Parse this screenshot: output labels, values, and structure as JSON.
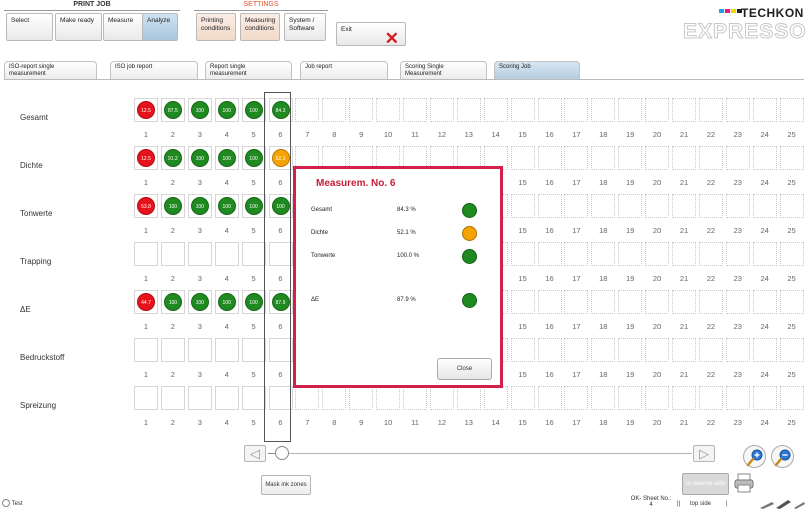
{
  "header": {
    "group_print_job": "PRINT JOB",
    "group_settings": "SETTINGS",
    "buttons": {
      "select": "Select",
      "make_ready": "Make ready",
      "measure": "Measure",
      "analyze": "Analyze",
      "printing_conditions_1": "Printing",
      "printing_conditions_2": "conditions",
      "measuring_conditions_1": "Measuring",
      "measuring_conditions_2": "conditions",
      "system_1": "System /",
      "system_2": "Software",
      "exit": "Exit"
    },
    "logo_brand": "TECHKON",
    "logo_main": "EXPRESSO"
  },
  "report_tabs": [
    {
      "line1": "ISO-report single",
      "line2": "measurement"
    },
    {
      "line1": "ISO job report",
      "line2": ""
    },
    {
      "line1": "Report single",
      "line2": "measurement"
    },
    {
      "line1": "Job report",
      "line2": ""
    },
    {
      "line1": "Scoring Single",
      "line2": "Measurement"
    },
    {
      "line1": "Scoring Job",
      "line2": ""
    }
  ],
  "column_numbers": [
    "1",
    "2",
    "3",
    "4",
    "5",
    "6",
    "7",
    "8",
    "9",
    "10",
    "11",
    "12",
    "13",
    "14",
    "15",
    "16",
    "17",
    "18",
    "19",
    "20",
    "21",
    "22",
    "23",
    "24",
    "25"
  ],
  "rows": [
    {
      "label": "Gesamt",
      "dots": [
        {
          "color": "red",
          "value": "12.5"
        },
        {
          "color": "green",
          "value": "87.5"
        },
        {
          "color": "green",
          "value": "100"
        },
        {
          "color": "green",
          "value": "100"
        },
        {
          "color": "green",
          "value": "100"
        },
        {
          "color": "green",
          "value": "84.3"
        }
      ]
    },
    {
      "label": "Dichte",
      "dots": [
        {
          "color": "red",
          "value": "12.5"
        },
        {
          "color": "green",
          "value": "91.2"
        },
        {
          "color": "green",
          "value": "100"
        },
        {
          "color": "green",
          "value": "100"
        },
        {
          "color": "green",
          "value": "100"
        },
        {
          "color": "orange",
          "value": "52.1"
        }
      ]
    },
    {
      "label": "Tonwerte",
      "dots": [
        {
          "color": "red",
          "value": "53.8"
        },
        {
          "color": "green",
          "value": "100"
        },
        {
          "color": "green",
          "value": "100"
        },
        {
          "color": "green",
          "value": "100"
        },
        {
          "color": "green",
          "value": "100"
        },
        {
          "color": "green",
          "value": "100"
        }
      ]
    },
    {
      "label": "Trapping",
      "dots": []
    },
    {
      "label": "ΔE",
      "dots": [
        {
          "color": "red",
          "value": "44.7"
        },
        {
          "color": "green",
          "value": "100"
        },
        {
          "color": "green",
          "value": "100"
        },
        {
          "color": "green",
          "value": "100"
        },
        {
          "color": "green",
          "value": "100"
        },
        {
          "color": "green",
          "value": "87.9"
        }
      ]
    },
    {
      "label": "Bedruckstoff",
      "dots": []
    },
    {
      "label": "Spreizung",
      "dots": []
    }
  ],
  "colors": {
    "red": "#e8121b",
    "green": "#1f8a1f",
    "orange": "#f5a300",
    "accent": "#d21f4c"
  },
  "modal": {
    "title": "Measurem. No. 6",
    "items": [
      {
        "label": "Gesamt",
        "value": "84.3 %",
        "color": "green"
      },
      {
        "label": "Dichte",
        "value": "52.1 %",
        "color": "orange"
      },
      {
        "label": "Tonwerte",
        "value": "100.0 %",
        "color": "green"
      },
      {
        "label": "ΔE",
        "value": "87.9 %",
        "color": "green"
      }
    ],
    "close_label": "Close"
  },
  "bottom": {
    "mask_ink_zones": "Mask ink zones",
    "to_reverse_side": "to reverse side"
  },
  "status_bar": {
    "job_name": "Test",
    "ok_sheet_label": "OK- Sheet No.:",
    "ok_sheet_value": "4",
    "side": "top side"
  }
}
